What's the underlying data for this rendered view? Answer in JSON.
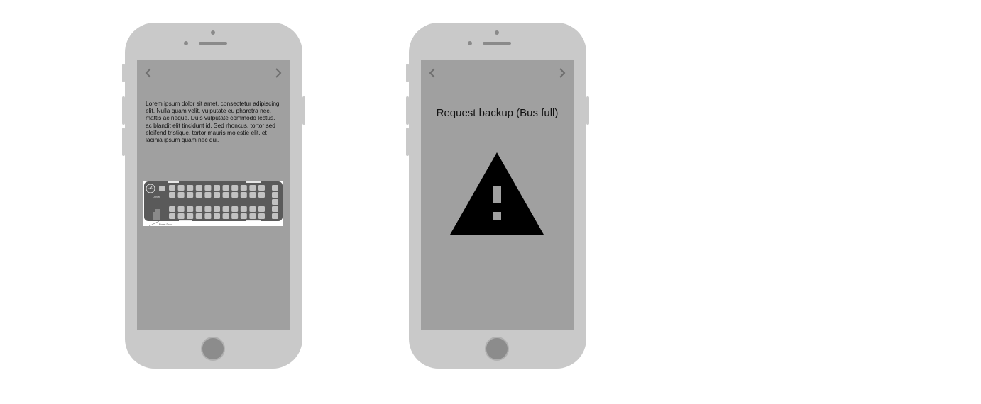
{
  "screens": [
    {
      "id": "seat-layout-screen",
      "nav": {
        "back_icon": "chevron-left-icon",
        "forward_icon": "chevron-right-icon"
      },
      "body_text": "Lorem ipsum dolor sit amet, consectetur adipiscing elit. Nulla quam velit, vulputate eu pharetra nec, mattis ac neque. Duis vulputate commodo lectus, ac blandit elit tincidunt id. Sed rhoncus, tortor sed eleifend tristique, tortor mauris molestie elit, et lacinia ipsum quam nec dui.",
      "bus_map": {
        "driver_label": "Driver",
        "front_door_label": "Front Door"
      }
    },
    {
      "id": "bus-full-screen",
      "nav": {
        "back_icon": "chevron-left-icon",
        "forward_icon": "chevron-right-icon"
      },
      "title": "Request backup (Bus full)",
      "icon": "warning-triangle-icon"
    }
  ],
  "colors": {
    "phone_body": "#c9c9c9",
    "screen_bg": "#a0a0a0",
    "seat": "#c2c2c2",
    "bus_body": "#5a5a5a",
    "warning": "#000000"
  }
}
